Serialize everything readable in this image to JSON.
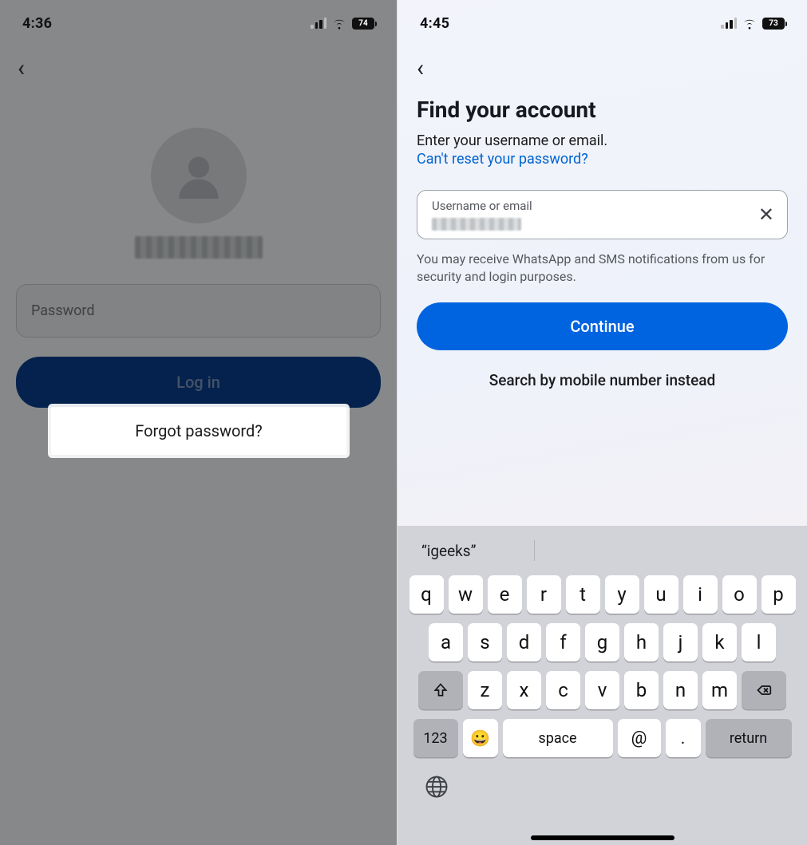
{
  "left": {
    "status": {
      "time": "4:36",
      "battery": "74"
    },
    "password_placeholder": "Password",
    "login_label": "Log in",
    "forgot_label": "Forgot password?"
  },
  "right": {
    "status": {
      "time": "4:45",
      "battery": "73"
    },
    "title": "Find your account",
    "subtitle": "Enter your username or email.",
    "reset_link": "Can't reset your password?",
    "input_label": "Username or email",
    "hint": "You may receive WhatsApp and SMS notifications from us for security and login purposes.",
    "continue_label": "Continue",
    "search_mobile_label": "Search by mobile number instead"
  },
  "keyboard": {
    "suggestion": "“igeeks”",
    "row1": [
      "q",
      "w",
      "e",
      "r",
      "t",
      "y",
      "u",
      "i",
      "o",
      "p"
    ],
    "row2": [
      "a",
      "s",
      "d",
      "f",
      "g",
      "h",
      "j",
      "k",
      "l"
    ],
    "row3": [
      "z",
      "x",
      "c",
      "v",
      "b",
      "n",
      "m"
    ],
    "num_key": "123",
    "space_key": "space",
    "at_key": "@",
    "dot_key": ".",
    "return_key": "return"
  }
}
